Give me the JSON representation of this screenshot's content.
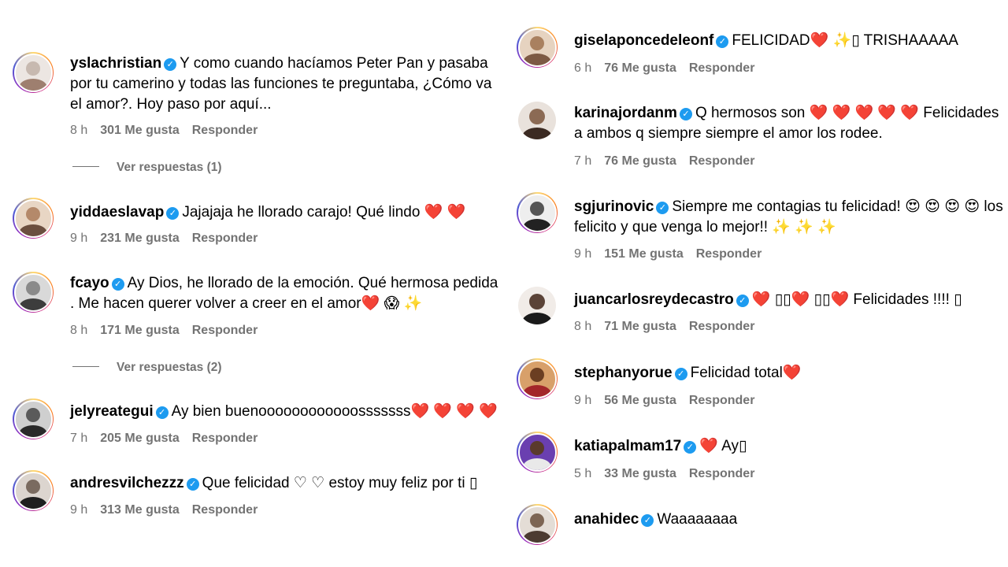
{
  "left_comments": [
    {
      "username": "yslachristian",
      "text": "Y como cuando hacíamos Peter Pan y pasaba por tu camerino y todas las funciones te preguntaba, ¿Cómo va el amor?. Hoy paso por aquí...",
      "time": "8 h",
      "likes": "301 Me gusta",
      "reply": "Responder",
      "view_replies": "Ver respuestas (1)"
    },
    {
      "username": "yiddaeslavap",
      "text": "Jajajaja he llorado carajo! Qué lindo ❤️ ❤️",
      "time": "9 h",
      "likes": "231 Me gusta",
      "reply": "Responder"
    },
    {
      "username": "fcayo",
      "text": "Ay Dios, he llorado de la emoción. Qué hermosa pedida . Me hacen querer volver a creer en el amor❤️ 😱 ✨",
      "time": "8 h",
      "likes": "171 Me gusta",
      "reply": "Responder",
      "view_replies": "Ver respuestas (2)"
    },
    {
      "username": "jelyreategui",
      "text": "Ay bien buenoooooooooooosssssss❤️ ❤️ ❤️ ❤️",
      "time": "7 h",
      "likes": "205 Me gusta",
      "reply": "Responder"
    },
    {
      "username": "andresvilchezzz",
      "text": "Que felicidad ♡ ♡ estoy muy feliz por ti ▯",
      "time": "9 h",
      "likes": "313 Me gusta",
      "reply": "Responder"
    }
  ],
  "right_comments": [
    {
      "username": "giselaponcedeleonf",
      "text": "FELICIDAD❤️ ✨▯ TRISHAAAAA",
      "time": "6 h",
      "likes": "76 Me gusta",
      "reply": "Responder"
    },
    {
      "username": "karinajordanm",
      "text": "Q hermosos son ❤️ ❤️ ❤️ ❤️ ❤️ Felicidades a ambos q siempre siempre el amor los rodee.",
      "time": "7 h",
      "likes": "76 Me gusta",
      "reply": "Responder"
    },
    {
      "username": "sgjurinovic",
      "text": "Siempre me contagias tu felicidad! 😍 😍 😍 😍 los felicito y que venga lo mejor!! ✨ ✨ ✨",
      "time": "9 h",
      "likes": "151 Me gusta",
      "reply": "Responder"
    },
    {
      "username": "juancarlosreydecastro",
      "text": "❤️ ▯▯❤️ ▯▯❤️  Felicidades !!!! ▯",
      "time": "8 h",
      "likes": "71 Me gusta",
      "reply": "Responder"
    },
    {
      "username": "stephanyorue",
      "text": "Felicidad total❤️",
      "time": "9 h",
      "likes": "56 Me gusta",
      "reply": "Responder"
    },
    {
      "username": "katiapalmam17",
      "text": "❤️ Ay▯",
      "time": "5 h",
      "likes": "33 Me gusta",
      "reply": "Responder"
    },
    {
      "username": "anahidec",
      "text": "Waaaaaaaa"
    }
  ],
  "colors": {
    "meta_gray": "#737373",
    "verified_blue": "#1d9bf0",
    "heart_red": "#e0245e"
  },
  "icons": {
    "verified": "verified-badge-icon",
    "ring": "story-ring"
  }
}
